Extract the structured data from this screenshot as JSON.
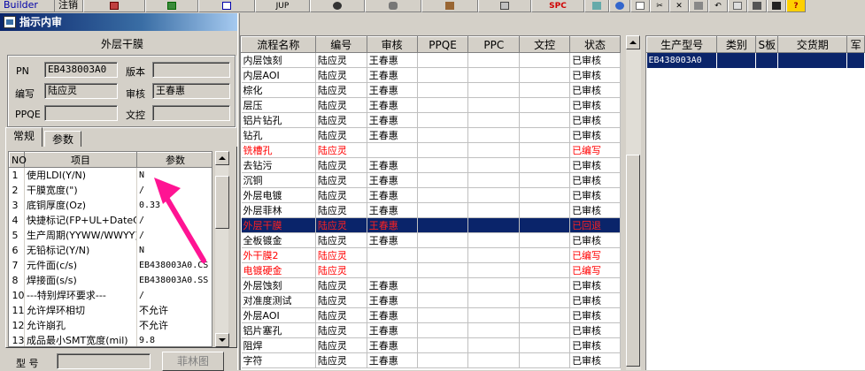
{
  "toolbar": {
    "left_text": "Builder",
    "logout": "注销",
    "jup": "JUP",
    "spc": "SPC"
  },
  "window": {
    "title": "指示内审"
  },
  "left": {
    "section_title": "外层干膜",
    "pn_label": "PN",
    "pn_value": "EB438003A0",
    "version_label": "版本",
    "version_value": "",
    "writer_label": "编写",
    "writer_value": "陆应灵",
    "review_label": "审核",
    "review_value": "王春惠",
    "ppqe_label": "PPQE",
    "ppqe_value": "",
    "doc_label": "文控",
    "doc_value": "",
    "tabs": [
      "常规",
      "参数"
    ],
    "params_headers": [
      "NO",
      "项目",
      "参数"
    ],
    "params": [
      {
        "no": "1",
        "item": "使用LDI(Y/N)",
        "val": "N"
      },
      {
        "no": "2",
        "item": "干膜宽度(\")",
        "val": "/"
      },
      {
        "no": "3",
        "item": "底铜厚度(Oz)",
        "val": "0.33"
      },
      {
        "no": "4",
        "item": "快捷标记(FP+UL+DateC",
        "val": "/"
      },
      {
        "no": "5",
        "item": "生产周期(YYWW/WWYY)",
        "val": "/"
      },
      {
        "no": "6",
        "item": "无铅标记(Y/N)",
        "val": "N"
      },
      {
        "no": "7",
        "item": "元件面(c/s)",
        "val": "EB438003A0.CS"
      },
      {
        "no": "8",
        "item": "焊接面(s/s)",
        "val": "EB438003A0.SS"
      },
      {
        "no": "10",
        "item": "---特别焊环要求---",
        "val": "/"
      },
      {
        "no": "11",
        "item": "允许焊环相切",
        "val": "不允许"
      },
      {
        "no": "12",
        "item": "允许崩孔",
        "val": "不允许"
      },
      {
        "no": "13",
        "item": "成品最小SMT宽度(mil)",
        "val": "9.8"
      }
    ],
    "model_label": "型  号",
    "model_value": "",
    "film_button": "菲林图"
  },
  "process": {
    "headers": [
      "流程名称",
      "编号",
      "审核",
      "PPQE",
      "PPC",
      "文控",
      "状态"
    ],
    "rows": [
      {
        "name": "内层蚀刻",
        "num": "陆应灵",
        "audit": "王春惠",
        "status": "已审核",
        "kind": "normal"
      },
      {
        "name": "内层AOI",
        "num": "陆应灵",
        "audit": "王春惠",
        "status": "已审核",
        "kind": "normal"
      },
      {
        "name": "棕化",
        "num": "陆应灵",
        "audit": "王春惠",
        "status": "已审核",
        "kind": "normal"
      },
      {
        "name": "层压",
        "num": "陆应灵",
        "audit": "王春惠",
        "status": "已审核",
        "kind": "normal"
      },
      {
        "name": "铝片钻孔",
        "num": "陆应灵",
        "audit": "王春惠",
        "status": "已审核",
        "kind": "normal"
      },
      {
        "name": "钻孔",
        "num": "陆应灵",
        "audit": "王春惠",
        "status": "已审核",
        "kind": "normal"
      },
      {
        "name": "铣槽孔",
        "num": "陆应灵",
        "audit": "",
        "status": "已编写",
        "kind": "red"
      },
      {
        "name": "去钻污",
        "num": "陆应灵",
        "audit": "王春惠",
        "status": "已审核",
        "kind": "normal"
      },
      {
        "name": "沉铜",
        "num": "陆应灵",
        "audit": "王春惠",
        "status": "已审核",
        "kind": "normal"
      },
      {
        "name": "外层电镀",
        "num": "陆应灵",
        "audit": "王春惠",
        "status": "已审核",
        "kind": "normal"
      },
      {
        "name": "外层菲林",
        "num": "陆应灵",
        "audit": "王春惠",
        "status": "已审核",
        "kind": "normal"
      },
      {
        "name": "外层干膜",
        "num": "陆应灵",
        "audit": "王春惠",
        "status": "已回退",
        "kind": "sel"
      },
      {
        "name": "全板镀金",
        "num": "陆应灵",
        "audit": "王春惠",
        "status": "已审核",
        "kind": "normal"
      },
      {
        "name": "外干膜2",
        "num": "陆应灵",
        "audit": "",
        "status": "已编写",
        "kind": "red"
      },
      {
        "name": "电镀硬金",
        "num": "陆应灵",
        "audit": "",
        "status": "已编写",
        "kind": "red"
      },
      {
        "name": "外层蚀刻",
        "num": "陆应灵",
        "audit": "王春惠",
        "status": "已审核",
        "kind": "normal"
      },
      {
        "name": "对准度测试",
        "num": "陆应灵",
        "audit": "王春惠",
        "status": "已审核",
        "kind": "normal"
      },
      {
        "name": "外层AOI",
        "num": "陆应灵",
        "audit": "王春惠",
        "status": "已审核",
        "kind": "normal"
      },
      {
        "name": "铝片塞孔",
        "num": "陆应灵",
        "audit": "王春惠",
        "status": "已审核",
        "kind": "normal"
      },
      {
        "name": "阻焊",
        "num": "陆应灵",
        "audit": "王春惠",
        "status": "已审核",
        "kind": "normal"
      },
      {
        "name": "字符",
        "num": "陆应灵",
        "audit": "王春惠",
        "status": "已审核",
        "kind": "normal"
      }
    ]
  },
  "product": {
    "headers": [
      "生产型号",
      "类别",
      "S板",
      "交货期",
      "军"
    ],
    "rows": [
      {
        "model": "EB438003A0",
        "cat": "",
        "s": "",
        "due": "",
        "mil": ""
      }
    ]
  },
  "colors": {
    "selection_bg": "#0a246a",
    "status_red": "#ff0000",
    "annotation_arrow": "#ff1493"
  }
}
